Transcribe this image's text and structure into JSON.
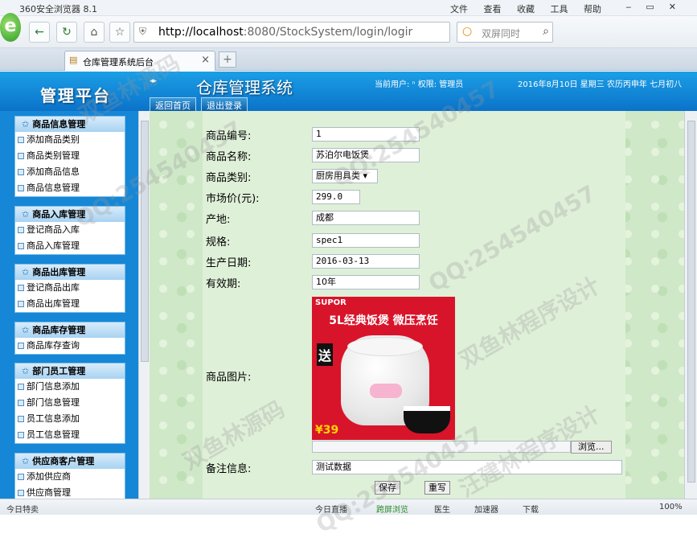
{
  "browser": {
    "title": "360安全浏览器 8.1",
    "menus": [
      "文件",
      "查看",
      "收藏",
      "工具",
      "帮助"
    ],
    "url_host": "http://localhost",
    "url_rest": ":8080/StockSystem/login/logir",
    "search_placeholder": "双屏同时",
    "tab_title": "仓库管理系统后台",
    "new_tab": "+"
  },
  "header": {
    "brand": "管理平台",
    "system_title": "仓库管理系统",
    "user_info": "当前用户: ⁿ 权限: 管理员",
    "date": "2016年8月10日 星期三 农历丙申年 七月初八",
    "home_btn": "返回首页",
    "logout_btn": "退出登录"
  },
  "sidebar": {
    "sections": [
      {
        "title": "商品信息管理",
        "items": [
          "添加商品类别",
          "商品类别管理",
          "添加商品信息",
          "商品信息管理"
        ]
      },
      {
        "title": "商品入库管理",
        "items": [
          "登记商品入库",
          "商品入库管理"
        ]
      },
      {
        "title": "商品出库管理",
        "items": [
          "登记商品出库",
          "商品出库管理"
        ]
      },
      {
        "title": "商品库存管理",
        "items": [
          "商品库存查询"
        ]
      },
      {
        "title": "部门员工管理",
        "items": [
          "部门信息添加",
          "部门信息管理",
          "员工信息添加",
          "员工信息管理"
        ]
      },
      {
        "title": "供应商客户管理",
        "items": [
          "添加供应商",
          "供应商管理"
        ]
      }
    ]
  },
  "form": {
    "fields": [
      {
        "label": "商品编号:",
        "value": "1"
      },
      {
        "label": "商品名称:",
        "value": "苏泊尔电饭煲"
      },
      {
        "label": "商品类别:",
        "value": "厨房用具类"
      },
      {
        "label": "市场价(元):",
        "value": "299.0"
      },
      {
        "label": "产地:",
        "value": "成都"
      },
      {
        "label": "规格:",
        "value": "spec1"
      },
      {
        "label": "生产日期:",
        "value": "2016-03-13"
      },
      {
        "label": "有效期:",
        "value": "10年"
      }
    ],
    "image_label": "商品图片:",
    "image_text": {
      "brand": "SUPOR",
      "banner": "5L经典饭煲 微压烹饪",
      "promo": "送",
      "price": "¥39"
    },
    "browse_btn": "浏览...",
    "remark_label": "备注信息:",
    "remark_value": "测试数据",
    "save_btn": "保存",
    "reset_btn": "重写"
  },
  "statusbar": {
    "items": [
      "今日特卖",
      "今日直播",
      "跨屏浏览",
      "医生",
      "加速器",
      "下载",
      "100%"
    ]
  },
  "watermarks": [
    "双鱼林源码",
    "QQ:254540457",
    "双鱼林程序设计",
    "汪建林程序设计"
  ]
}
